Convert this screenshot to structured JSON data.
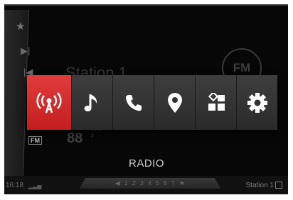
{
  "left_bar": {
    "icons": [
      "star-icon",
      "skip-next-icon",
      "skip-previous-icon"
    ],
    "band_label": "FM"
  },
  "background": {
    "station_name": "Station 1",
    "band_badge": "FM",
    "frequency": "88",
    "frequency_unit_top": "MHz",
    "frequency_unit_bottom": "5"
  },
  "dock": {
    "items": [
      {
        "name": "radio",
        "icon": "radio-antenna-icon",
        "active": true
      },
      {
        "name": "media",
        "icon": "music-note-icon",
        "active": false
      },
      {
        "name": "phone",
        "icon": "phone-icon",
        "active": false
      },
      {
        "name": "navigation",
        "icon": "map-pin-icon",
        "active": false
      },
      {
        "name": "apps",
        "icon": "apps-grid-icon",
        "active": false
      },
      {
        "name": "settings",
        "icon": "gear-icon",
        "active": false
      }
    ],
    "accent_color": "#d42a2a"
  },
  "screen_title": "RADIO",
  "status_bar": {
    "time": "16:18",
    "presets": [
      "1",
      "2",
      "3",
      "4",
      "5",
      "6",
      "7"
    ],
    "station": "Station 1"
  }
}
